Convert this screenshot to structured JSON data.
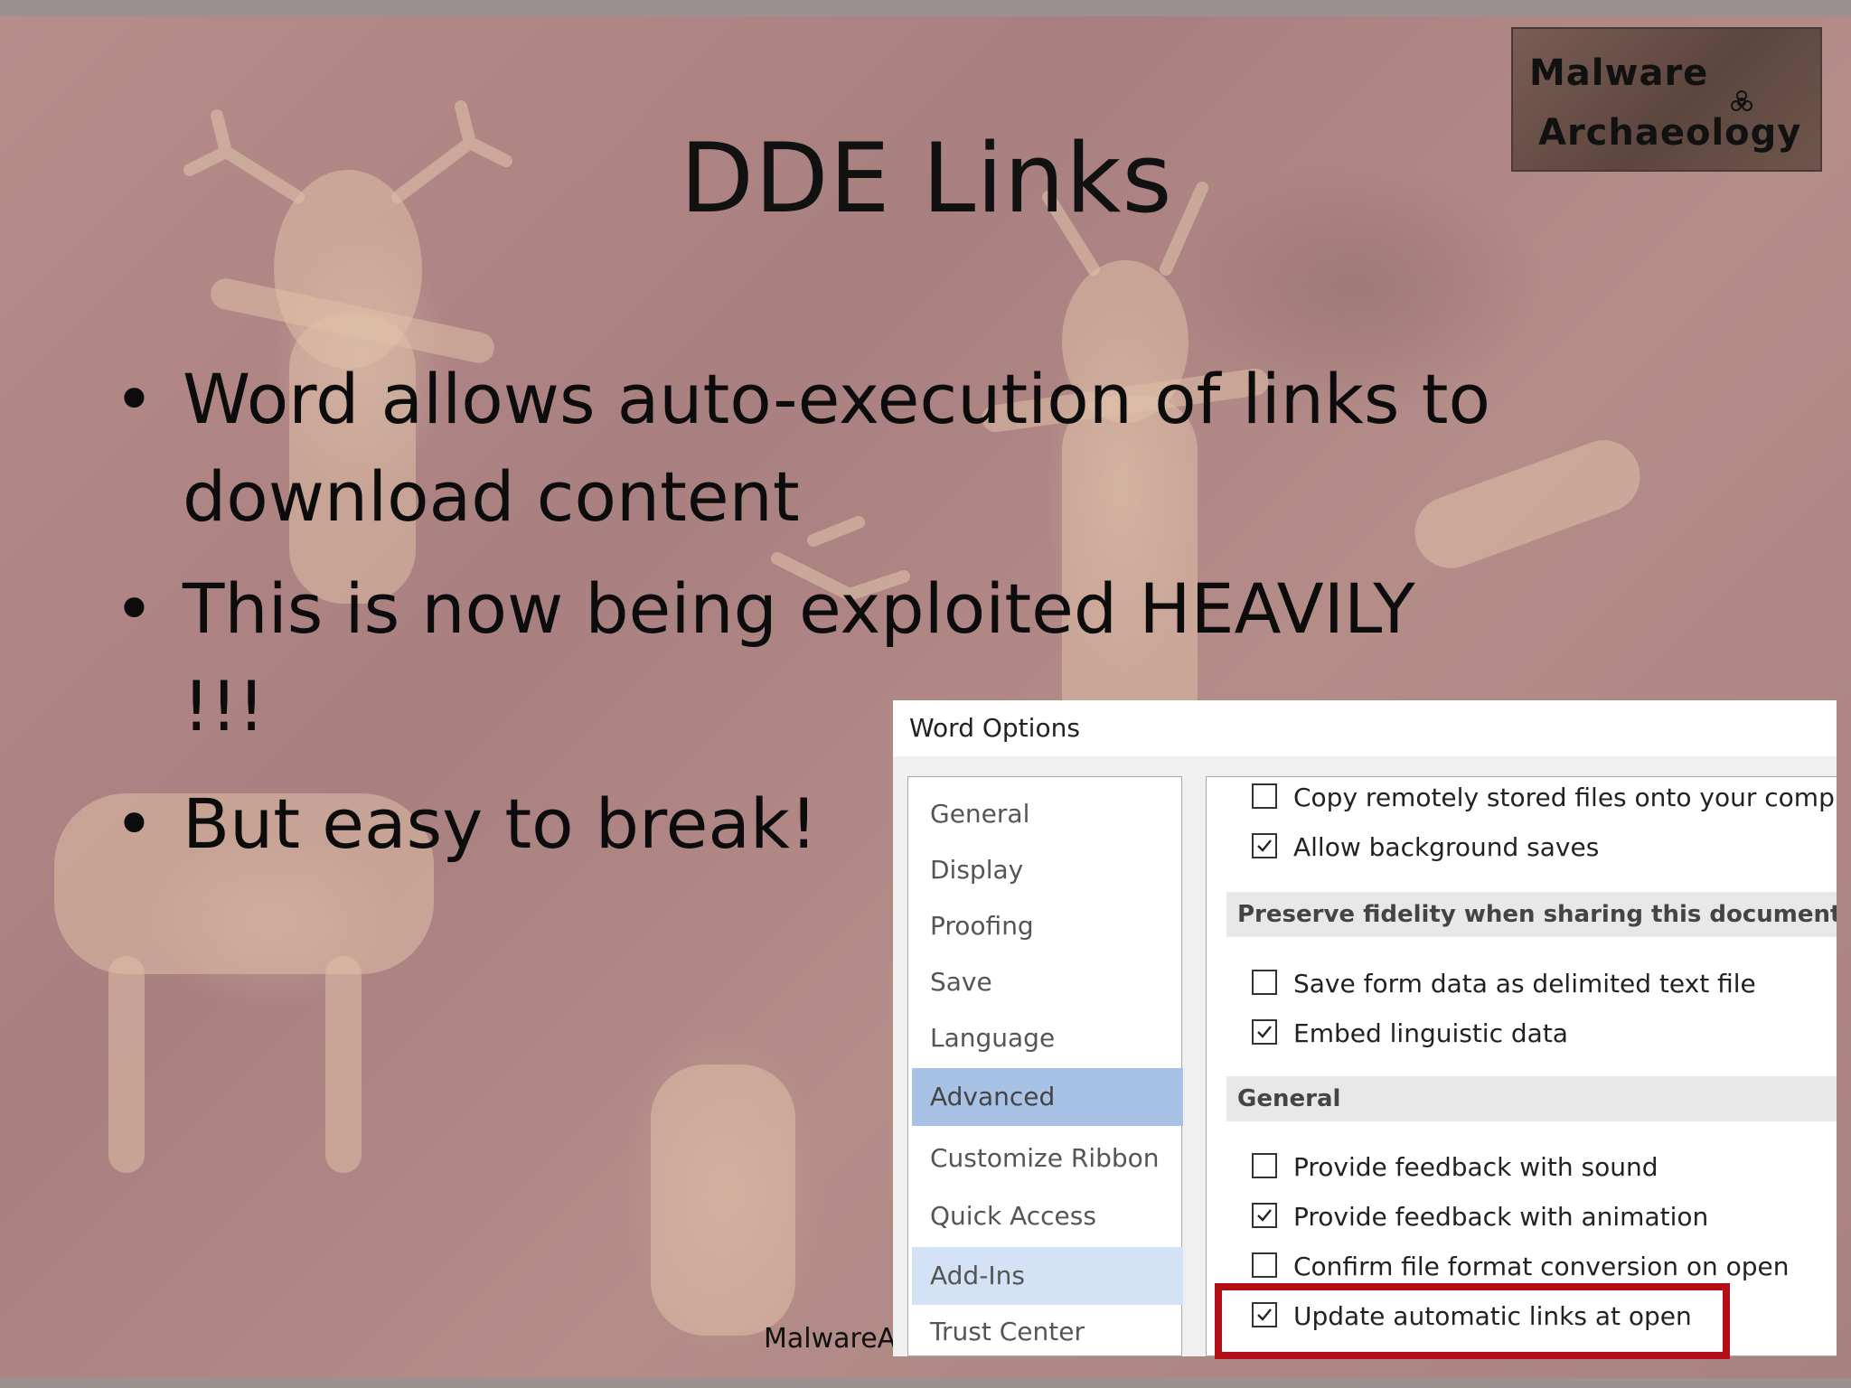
{
  "slide": {
    "title": "DDE Links",
    "logo": {
      "line1": "Malware",
      "line2": "Archaeology",
      "icon": "biohazard-icon"
    },
    "bullets": [
      "Word allows auto-execution of links to download content",
      "This is now being exploited HEAVILY !!!",
      "But easy to break!"
    ],
    "bullet_glyph": "•",
    "footer": "MalwareAr"
  },
  "word_options": {
    "title": "Word Options",
    "nav": [
      {
        "label": "General",
        "state": "normal"
      },
      {
        "label": "Display",
        "state": "normal"
      },
      {
        "label": "Proofing",
        "state": "normal"
      },
      {
        "label": "Save",
        "state": "normal"
      },
      {
        "label": "Language",
        "state": "normal"
      },
      {
        "label": "Advanced",
        "state": "selected"
      },
      {
        "label": "Customize Ribbon",
        "state": "normal"
      },
      {
        "label": "Quick Access Toolbar",
        "state": "normal"
      },
      {
        "label": "Add-Ins",
        "state": "hover"
      },
      {
        "label": "Trust Center",
        "state": "normal"
      }
    ],
    "options_top": [
      {
        "label": "Copy remotely stored files onto your computer,",
        "checked": false
      },
      {
        "label": "Allow background saves",
        "checked": true
      }
    ],
    "section_fidelity": "Preserve fidelity when sharing this document:",
    "options_fidelity": [
      {
        "label": "Save form data as delimited text file",
        "checked": false
      },
      {
        "label": "Embed linguistic data",
        "checked": true
      }
    ],
    "section_general": "General",
    "options_general": [
      {
        "label": "Provide feedback with sound",
        "checked": false
      },
      {
        "label": "Provide feedback with animation",
        "checked": true
      },
      {
        "label": "Confirm file format conversion on open",
        "checked": false
      },
      {
        "label": "Update automatic links at open",
        "checked": true
      }
    ],
    "highlight_color": "#b20f16",
    "selected_nav_color": "#a8c2e6"
  }
}
